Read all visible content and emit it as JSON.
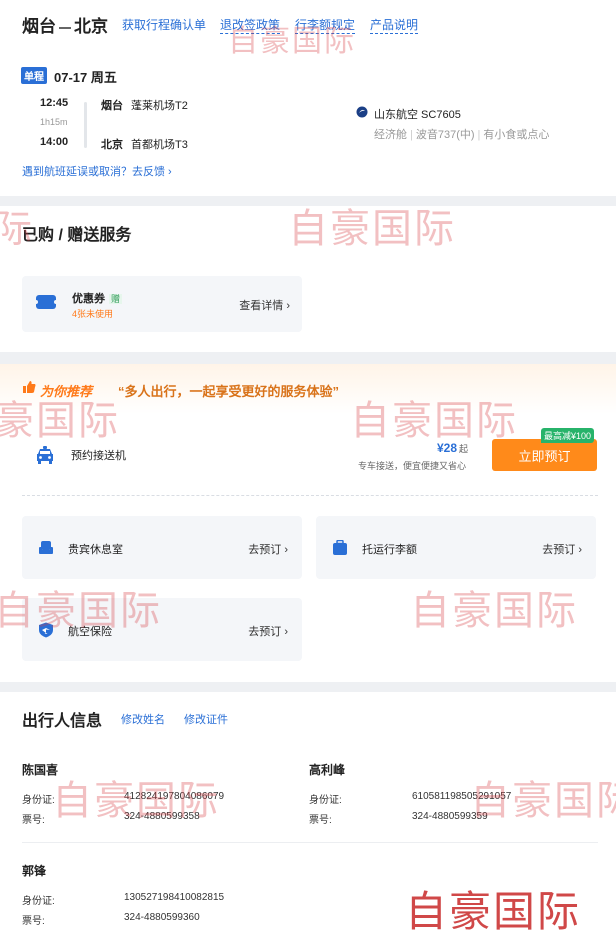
{
  "header": {
    "from_city": "烟台",
    "to_city": "北京",
    "links": [
      "获取行程确认单",
      "退改签政策",
      "行李额规定",
      "产品说明"
    ]
  },
  "flight": {
    "trip_type": "单程",
    "date": "07-17 周五",
    "dep_time": "12:45",
    "duration": "1h15m",
    "arr_time": "14:00",
    "dep_city": "烟台",
    "dep_airport": "蓬莱机场T2",
    "arr_city": "北京",
    "arr_airport": "首都机场T3",
    "airline": "山东航空 SC7605",
    "cabin": "经济舱",
    "aircraft": "波音737(中)",
    "meal": "有小食或点心",
    "feedback": "遇到航班延误或取消？去反馈"
  },
  "purchased": {
    "title": "已购 / 赠送服务",
    "coupon_name": "优惠券",
    "gift_tag": "赠",
    "coupon_count": "4张未使用",
    "view_detail": "查看详情"
  },
  "recommend": {
    "tag": "为你推荐",
    "slogan": "“多人出行，一起享受更好的服务体验”",
    "transfer_label": "预约接送机",
    "price": "¥28",
    "price_suffix": "起",
    "transfer_desc": "专车接送，便宜便捷又省心",
    "discount_badge": "最高减¥100",
    "book_button": "立即预订",
    "services": [
      {
        "label": "贵宾休息室",
        "action": "去预订"
      },
      {
        "label": "托运行李额",
        "action": "去预订"
      },
      {
        "label": "航空保险",
        "action": "去预订"
      }
    ]
  },
  "passengers": {
    "title": "出行人信息",
    "edit_name": "修改姓名",
    "edit_id": "修改证件",
    "id_label": "身份证:",
    "ticket_label": "票号:",
    "list": [
      {
        "name": "陈国喜",
        "id": "412824197804086079",
        "ticket": "324-4880599358"
      },
      {
        "name": "高利峰",
        "id": "610581198505291057",
        "ticket": "324-4880599359"
      },
      {
        "name": "郭锋",
        "id": "130527198410082815",
        "ticket": "324-4880599360"
      }
    ]
  },
  "watermark": "自豪国际",
  "colors": {
    "accent": "#2a6fd6",
    "orange": "#ff8a1a",
    "green": "#27b36a",
    "watermark": "#d63c42"
  }
}
